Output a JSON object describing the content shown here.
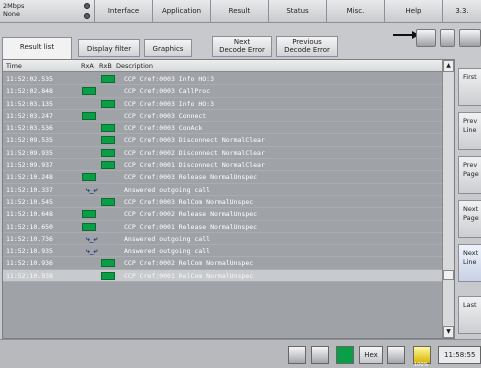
{
  "status": {
    "speed": "2Mbps",
    "mode": "None"
  },
  "menu": [
    "Interface",
    "Application",
    "Result",
    "Status",
    "Misc.",
    "Help",
    "3.3."
  ],
  "toolbar": {
    "tabs": [
      "Result list",
      "Display filter",
      "Graphics"
    ],
    "decode_next": [
      "Next",
      "Decode Error"
    ],
    "decode_prev": [
      "Previous",
      "Decode Error"
    ]
  },
  "columns": {
    "time": "Time",
    "rxa": "RxA",
    "rxb": "RxB",
    "description": "Description"
  },
  "rows": [
    {
      "time": "11:52:02.535",
      "dir": "B",
      "desc": "CCP Cref:0003 Info HO:3"
    },
    {
      "time": "11:52:02.848",
      "dir": "A",
      "desc": "CCP Cref:0003 CallProc"
    },
    {
      "time": "11:52:03.135",
      "dir": "B",
      "desc": "CCP Cref:0003 Info HO:3"
    },
    {
      "time": "11:52:03.247",
      "dir": "A",
      "desc": "CCP Cref:0003 Connect"
    },
    {
      "time": "11:52:03.536",
      "dir": "B",
      "desc": "CCP Cref:0003 ConAck"
    },
    {
      "time": "11:52:09.535",
      "dir": "B",
      "desc": "CCP Cref:0003 Disconnect NormalClear"
    },
    {
      "time": "11:52:09.935",
      "dir": "B",
      "desc": "CCP Cref:0002 Disconnect NormalClear"
    },
    {
      "time": "11:52:09.937",
      "dir": "B",
      "desc": "CCP Cref:0001 Disconnect NormalClear"
    },
    {
      "time": "11:52:10.248",
      "dir": "A",
      "desc": "CCP Cref:0003 Release NormalUnspec"
    },
    {
      "time": "11:52:10.337",
      "dir": "C",
      "desc": "Answered outgoing call"
    },
    {
      "time": "11:52:10.545",
      "dir": "B",
      "desc": "CCP Cref:0003 RelCom NormalUnspec"
    },
    {
      "time": "11:52:10.648",
      "dir": "A",
      "desc": "CCP Cref:0002 Release NormalUnspec"
    },
    {
      "time": "11:52:10.650",
      "dir": "A",
      "desc": "CCP Cref:0001 Release NormalUnspec"
    },
    {
      "time": "11:52:10.736",
      "dir": "C",
      "desc": "Answered outgoing call"
    },
    {
      "time": "11:52:10.935",
      "dir": "C",
      "desc": "Answered outgoing call"
    },
    {
      "time": "11:52:10.936",
      "dir": "B",
      "desc": "CCP Cref:0002 RelCom NormalUnspec"
    },
    {
      "time": "11:52:10.938",
      "dir": "B",
      "desc": "CCP Cref:0001 RelCom NormalUnspec",
      "selected": true
    }
  ],
  "side_buttons": [
    [
      "First"
    ],
    [
      "Prev",
      "Line"
    ],
    [
      "Prev",
      "Page"
    ],
    [
      "Next",
      "Page"
    ],
    [
      "Next",
      "Line"
    ],
    [
      "Last"
    ]
  ],
  "statusbar": {
    "hex": "Hex",
    "battery": "100%",
    "clock": "11:58:55"
  },
  "colors": {
    "envelope": "#0a9f46",
    "panel": "#9fa2a7"
  }
}
